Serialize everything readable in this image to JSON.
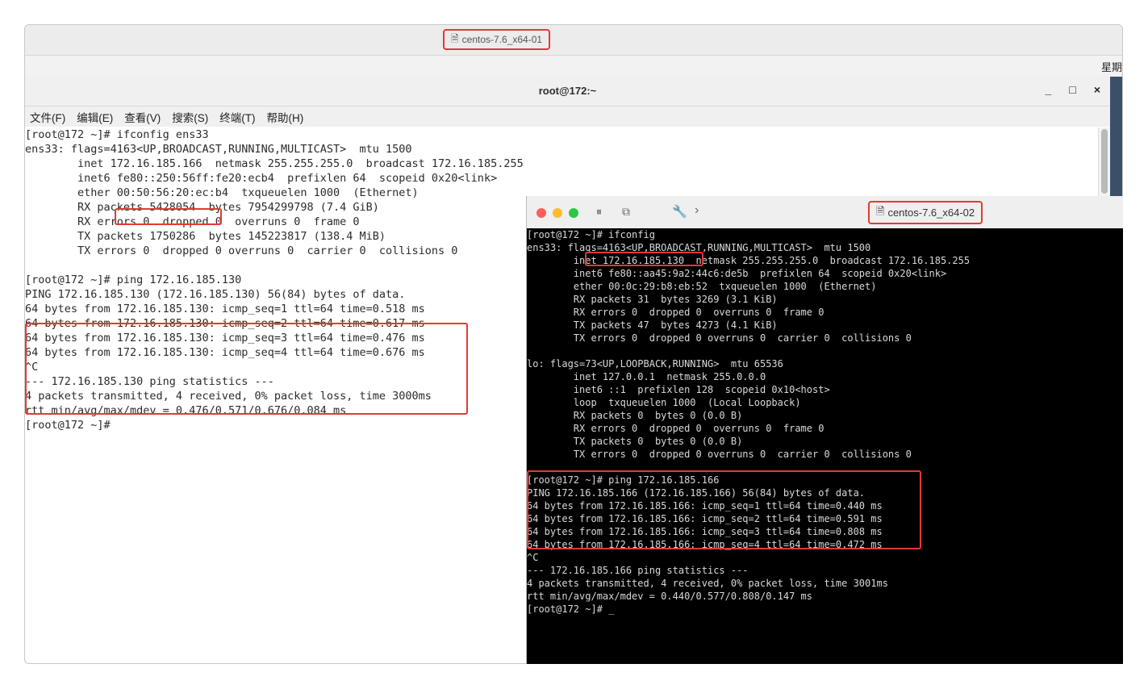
{
  "vm1": {
    "tab_title": "centos-7.6_x64-01",
    "clock": "星期"
  },
  "terminal": {
    "title": "root@172:~",
    "controls": [
      "_",
      "□",
      "×"
    ],
    "menu": [
      "文件(F)",
      "编辑(E)",
      "查看(V)",
      "搜索(S)",
      "终端(T)",
      "帮助(H)"
    ],
    "lines": [
      "[root@172 ~]# ifconfig ens33",
      "ens33: flags=4163<UP,BROADCAST,RUNNING,MULTICAST>  mtu 1500",
      "        inet 172.16.185.166  netmask 255.255.255.0  broadcast 172.16.185.255",
      "        inet6 fe80::250:56ff:fe20:ecb4  prefixlen 64  scopeid 0x20<link>",
      "        ether 00:50:56:20:ec:b4  txqueuelen 1000  (Ethernet)",
      "        RX packets 5428054  bytes 7954299798 (7.4 GiB)",
      "        RX errors 0  dropped 0  overruns 0  frame 0",
      "        TX packets 1750286  bytes 145223817 (138.4 MiB)",
      "        TX errors 0  dropped 0 overruns 0  carrier 0  collisions 0",
      "",
      "[root@172 ~]# ping 172.16.185.130",
      "PING 172.16.185.130 (172.16.185.130) 56(84) bytes of data.",
      "64 bytes from 172.16.185.130: icmp_seq=1 ttl=64 time=0.518 ms",
      "64 bytes from 172.16.185.130: icmp_seq=2 ttl=64 time=0.617 ms",
      "64 bytes from 172.16.185.130: icmp_seq=3 ttl=64 time=0.476 ms",
      "64 bytes from 172.16.185.130: icmp_seq=4 ttl=64 time=0.676 ms",
      "^C",
      "--- 172.16.185.130 ping statistics ---",
      "4 packets transmitted, 4 received, 0% packet loss, time 3000ms",
      "rtt min/avg/max/mdev = 0.476/0.571/0.676/0.084 ms",
      "[root@172 ~]#"
    ]
  },
  "vm2": {
    "tab_title": "centos-7.6_x64-02",
    "traffic_lights": [
      "#ff5f57",
      "#febc2e",
      "#28c840"
    ],
    "toolbar_icons": [
      "pause-icon",
      "snapshot-icon",
      "settings-wrench-icon",
      "forward-chevron-icon"
    ],
    "lines": [
      "[root@172 ~]# ifconfig",
      "ens33: flags=4163<UP,BROADCAST,RUNNING,MULTICAST>  mtu 1500",
      "        inet 172.16.185.130  netmask 255.255.255.0  broadcast 172.16.185.255",
      "        inet6 fe80::aa45:9a2:44c6:de5b  prefixlen 64  scopeid 0x20<link>",
      "        ether 00:0c:29:b8:eb:52  txqueuelen 1000  (Ethernet)",
      "        RX packets 31  bytes 3269 (3.1 KiB)",
      "        RX errors 0  dropped 0  overruns 0  frame 0",
      "        TX packets 47  bytes 4273 (4.1 KiB)",
      "        TX errors 0  dropped 0 overruns 0  carrier 0  collisions 0",
      "",
      "lo: flags=73<UP,LOOPBACK,RUNNING>  mtu 65536",
      "        inet 127.0.0.1  netmask 255.0.0.0",
      "        inet6 ::1  prefixlen 128  scopeid 0x10<host>",
      "        loop  txqueuelen 1000  (Local Loopback)",
      "        RX packets 0  bytes 0 (0.0 B)",
      "        RX errors 0  dropped 0  overruns 0  frame 0",
      "        TX packets 0  bytes 0 (0.0 B)",
      "        TX errors 0  dropped 0 overruns 0  carrier 0  collisions 0",
      "",
      "[root@172 ~]# ping 172.16.185.166",
      "PING 172.16.185.166 (172.16.185.166) 56(84) bytes of data.",
      "64 bytes from 172.16.185.166: icmp_seq=1 ttl=64 time=0.440 ms",
      "64 bytes from 172.16.185.166: icmp_seq=2 ttl=64 time=0.591 ms",
      "64 bytes from 172.16.185.166: icmp_seq=3 ttl=64 time=0.808 ms",
      "64 bytes from 172.16.185.166: icmp_seq=4 ttl=64 time=0.472 ms",
      "^C",
      "--- 172.16.185.166 ping statistics ---",
      "4 packets transmitted, 4 received, 0% packet loss, time 3001ms",
      "rtt min/avg/max/mdev = 0.440/0.577/0.808/0.147 ms",
      "[root@172 ~]# _"
    ]
  },
  "colors": {
    "highlight": "#e53935",
    "console_bg": "#000000",
    "console_fg": "#d9d9d9"
  }
}
